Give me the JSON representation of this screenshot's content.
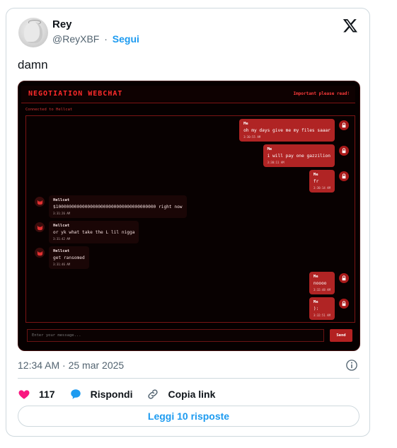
{
  "tweet": {
    "author_name": "Rey",
    "handle": "@ReyXBF",
    "separator": "·",
    "follow_label": "Segui",
    "text": "damn",
    "timestamp": "12:34 AM · 25 mar 2025",
    "likes_count": "117",
    "reply_label": "Rispondi",
    "copy_link_label": "Copia link",
    "read_replies_label": "Leggi 10 risposte",
    "colors": {
      "accent": "#1d9bf0",
      "like": "#f91880",
      "muted": "#536471"
    }
  },
  "webchat": {
    "title": "NEGOTIATION WEBCHAT",
    "important_link": "Important please read!",
    "status": "Connected to Hellcat",
    "input_placeholder": "Enter your message...",
    "send_label": "Send",
    "colors": {
      "primary": "#ff2b2b",
      "bubble_me": "#b02424",
      "bubble_them": "#1a0606",
      "background": "#060000"
    },
    "messages": [
      {
        "sender": "Me",
        "text": "oh my days give me my files saaar",
        "time": "3:30:55 AM",
        "side": "me"
      },
      {
        "sender": "Me",
        "text": "i will pay one gazzilion",
        "time": "3:30:11 AM",
        "side": "me"
      },
      {
        "sender": "Me",
        "text": "fr",
        "time": "3:30:14 AM",
        "side": "me"
      },
      {
        "sender": "Hellcat",
        "text": "$10000000000000000000000000000000000000 right now",
        "time": "3:31:26 AM",
        "side": "them"
      },
      {
        "sender": "Hellcat",
        "text": "or yk what take the L lil nigga",
        "time": "3:31:42 AM",
        "side": "them"
      },
      {
        "sender": "Hellcat",
        "text": "get ransomed",
        "time": "3:31:46 AM",
        "side": "them"
      },
      {
        "sender": "Me",
        "text": "noooo",
        "time": "3:32:48 AM",
        "side": "me"
      },
      {
        "sender": "Me",
        "text": "):",
        "time": "3:32:51 AM",
        "side": "me"
      }
    ]
  }
}
